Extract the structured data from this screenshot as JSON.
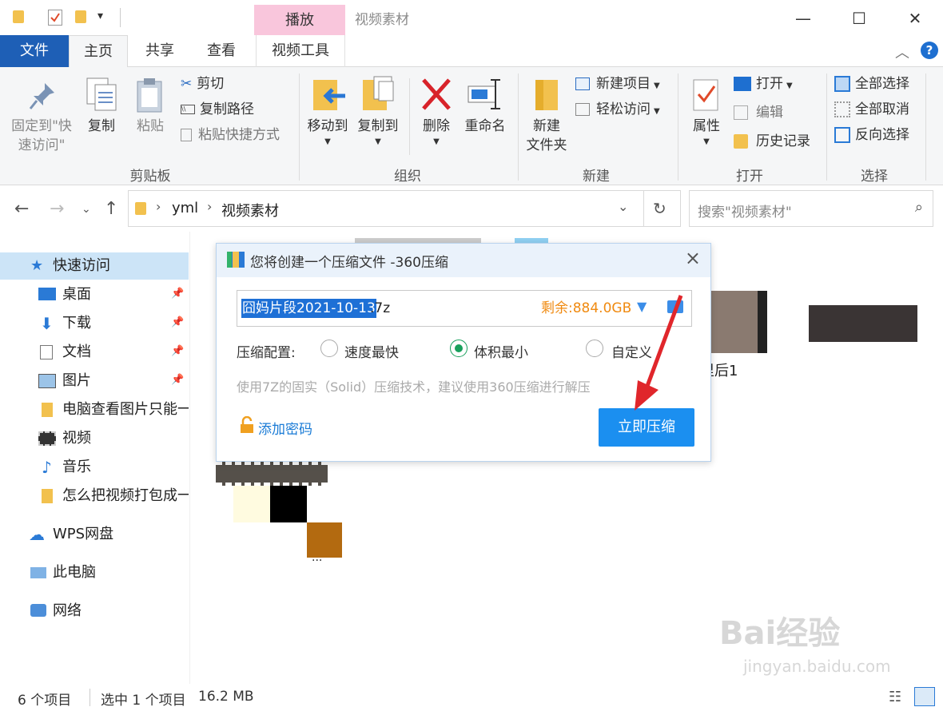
{
  "titlebar": {
    "context_tab": "播放",
    "window_title": "视频素材",
    "minimize": "—",
    "maximize": "☐",
    "close": "✕"
  },
  "tabs": {
    "file": "文件",
    "home": "主页",
    "share": "共享",
    "view": "查看",
    "video_tools": "视频工具",
    "help": "?"
  },
  "ribbon": {
    "clipboard": {
      "pin_quick": "固定到\"快\n速访问\"",
      "copy": "复制",
      "paste": "粘贴",
      "cut": "剪切",
      "copy_path": "复制路径",
      "paste_shortcut": "粘贴快捷方式",
      "label": "剪贴板"
    },
    "organize": {
      "move_to": "移动到",
      "copy_to": "复制到",
      "delete": "删除",
      "rename": "重命名",
      "label": "组织"
    },
    "new": {
      "new_folder": "新建\n文件夹",
      "new_item": "新建项目",
      "easy_access": "轻松访问",
      "label": "新建"
    },
    "open": {
      "properties": "属性",
      "open": "打开",
      "edit": "编辑",
      "history": "历史记录",
      "label": "打开"
    },
    "select": {
      "select_all": "全部选择",
      "select_none": "全部取消",
      "invert": "反向选择",
      "label": "选择"
    }
  },
  "address": {
    "crumb1": "yml",
    "crumb2": "视频素材",
    "search_placeholder": "搜索\"视频素材\""
  },
  "sidebar": {
    "quick_access": "快速访问",
    "desktop": "桌面",
    "downloads": "下载",
    "documents": "文档",
    "pictures": "图片",
    "folder1": "电脑查看图片只能一",
    "videos": "视频",
    "music": "音乐",
    "folder2": "怎么把视频打包成一",
    "wps": "WPS网盘",
    "this_pc": "此电脑",
    "network": "网络"
  },
  "files": {
    "partial_label": "里后1",
    "ellipsis": "..."
  },
  "status": {
    "count": "6 个项目",
    "selected": "选中 1 个项目",
    "size": "16.2 MB"
  },
  "dialog": {
    "title": "您将创建一个压缩文件 -360压缩",
    "filename_selected": "囧妈片段2021-10-13",
    "filename_ext": ".7z",
    "free_space": "剩余:884.0GB",
    "config_label": "压缩配置:",
    "opt_fast": "速度最快",
    "opt_small": "体积最小",
    "opt_custom": "自定义",
    "hint": "使用7Z的固实（Solid）压缩技术，建议使用360压缩进行解压",
    "add_password": "添加密码",
    "compress_now": "立即压缩"
  },
  "watermark": {
    "main": "Bai经验",
    "url": "jingyan.baidu.com"
  },
  "colors": {
    "file_tab": "#1e5fb6",
    "context_tab": "#f9c6dc",
    "compress_button": "#1b8ff0",
    "free_space": "#f08a10",
    "radio_on": "#19a05c",
    "arrow": "#e0262b"
  }
}
